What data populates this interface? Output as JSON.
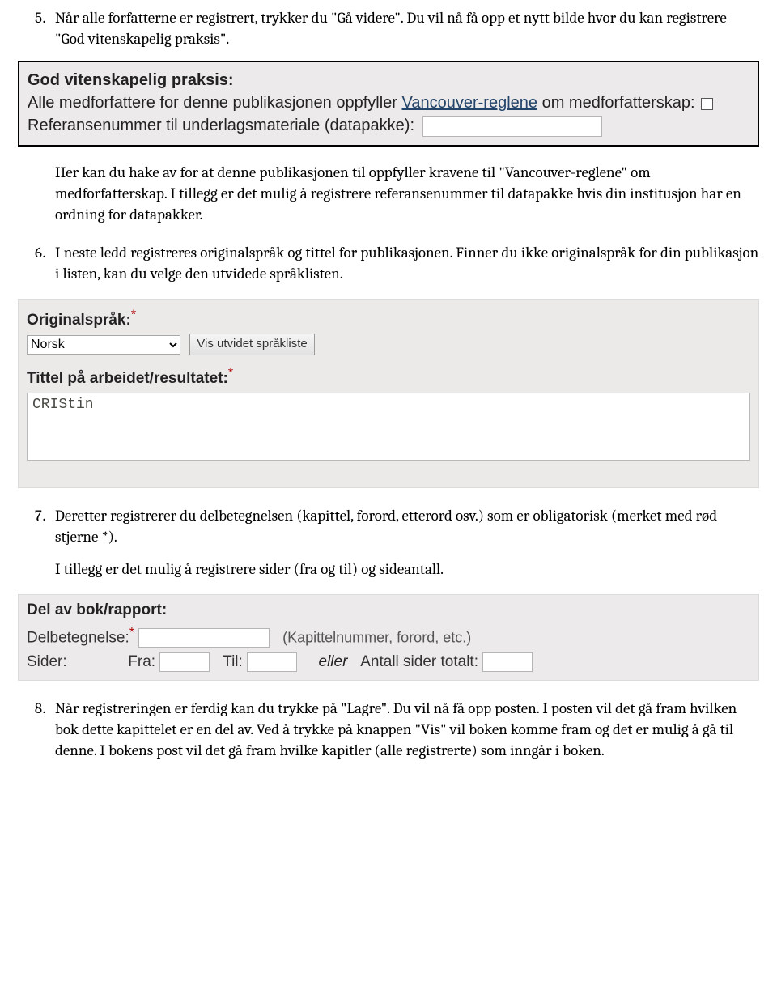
{
  "step5": {
    "text": "Når alle forfatterne er registrert, trykker du \"Gå videre\". Du vil nå få opp et nytt bilde hvor du kan registrere \"God vitenskapelig praksis\"."
  },
  "box1": {
    "title": "God vitenskapelig praksis:",
    "line_a_pre": "Alle medforfattere for denne publikasjonen oppfyller ",
    "line_a_link": "Vancouver-reglene",
    "line_a_post": " om medforfatterskap:",
    "line_b": "Referansenummer til underlagsmateriale (datapakke):"
  },
  "after5": "Her kan du hake av for at denne publikasjonen til oppfyller kravene til \"Vancouver-reglene\" om medforfatterskap. I tillegg er det mulig å registrere referansenummer til datapakke hvis din institusjon har en ordning for datapakker.",
  "step6": {
    "text": "I neste ledd registreres originalspråk og tittel for publikasjonen. Finner du ikke originalspråk for din publikasjon i listen, kan du velge den utvidede språklisten."
  },
  "form1": {
    "lang_label": "Originalspråk:",
    "lang_value": "Norsk",
    "lang_btn": "Vis utvidet språkliste",
    "title_label": "Tittel på arbeidet/resultatet:",
    "title_value": "CRIStin"
  },
  "step7": {
    "p1": "Deretter registrerer du delbetegnelsen (kapittel, forord, etterord osv.) som er obligatorisk (merket med rød stjerne *).",
    "p2": "I tillegg er det mulig å registrere sider (fra og til) og sideantall."
  },
  "form2": {
    "heading": "Del av bok/rapport:",
    "delbet_label": "Delbetegnelse:",
    "delbet_hint": "(Kapittelnummer, forord, etc.)",
    "sider_label": "Sider:",
    "fra_label": "Fra:",
    "til_label": "Til:",
    "or": "eller",
    "total_label": "Antall sider totalt:"
  },
  "step8": {
    "text": "Når registreringen er ferdig kan du trykke på \"Lagre\". Du vil nå få opp posten. I posten vil det gå fram hvilken bok dette kapittelet er en del av. Ved å trykke på knappen \"Vis\" vil boken komme fram og det er mulig å gå til denne. I bokens post vil det gå fram hvilke kapitler (alle registrerte) som inngår i boken."
  }
}
